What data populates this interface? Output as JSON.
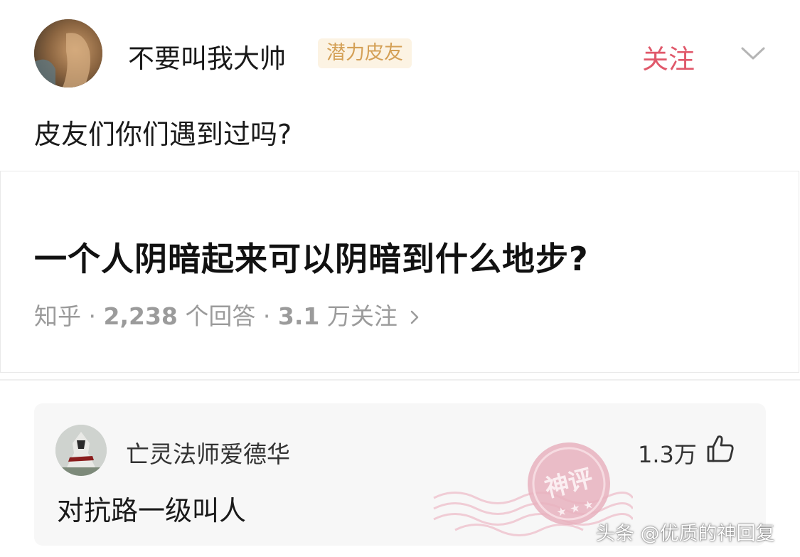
{
  "post": {
    "author": {
      "name": "不要叫我大帅",
      "badge": "潜力皮友"
    },
    "follow_label": "关注",
    "text": "皮友们你们遇到过吗?"
  },
  "linked_card": {
    "title": "一个人阴暗起来可以阴暗到什么地步?",
    "source": "知乎",
    "answers_count": "2,238",
    "answers_label": "个回答",
    "followers_count": "3.1",
    "followers_label": "万关注",
    "separator": "·"
  },
  "comment": {
    "author": "亡灵法师爱德华",
    "likes": "1.3万",
    "text": "对抗路一级叫人",
    "stamp_text": "神评"
  },
  "watermark": "头条 @优质的神回复",
  "colors": {
    "accent_follow": "#e0586a",
    "badge_text": "#d4a056",
    "badge_bg": "#fcf3e3",
    "stamp": "#e4a3b2"
  },
  "icons": [
    "chevron-down-icon",
    "chevron-right-icon",
    "thumbs-up-icon"
  ]
}
